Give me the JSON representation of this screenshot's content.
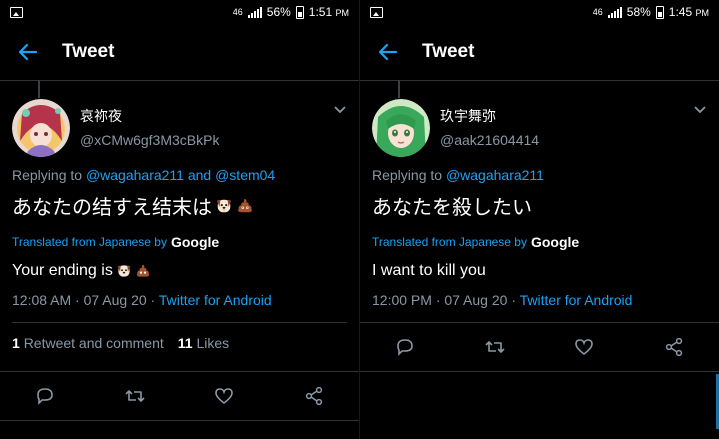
{
  "left": {
    "status": {
      "signal": "46",
      "battery": "56%",
      "time": "1:51",
      "ampm": "PM"
    },
    "header": {
      "title": "Tweet"
    },
    "tweet": {
      "display_name": "哀祢夜",
      "handle": "@xCMw6gf3M3cBkPk",
      "replying_prefix": "Replying to",
      "mentions": "@wagahara211 and @stem04",
      "text": "あなたの结すえ结末は",
      "translated_prefix": "Translated from Japanese by",
      "translated_brand": "Google",
      "translation": "Your ending is",
      "time_date": "12:08 AM · 07 Aug 20 ·",
      "source": "Twitter for Android"
    },
    "stats": {
      "retweets": "1",
      "retweet_label": "Retweet and comment",
      "likes": "11",
      "like_label": "Likes"
    }
  },
  "right": {
    "status": {
      "signal": "46",
      "battery": "58%",
      "time": "1:45",
      "ampm": "PM"
    },
    "header": {
      "title": "Tweet"
    },
    "tweet": {
      "display_name": "玖宇舞弥",
      "handle": "@aak21604414",
      "replying_prefix": "Replying to",
      "mentions": "@wagahara211",
      "text": "あなたを殺したい",
      "translated_prefix": "Translated from Japanese by",
      "translated_brand": "Google",
      "translation": "I want to kill you",
      "time_date": "12:00 PM · 07 Aug 20 ·",
      "source": "Twitter for Android"
    }
  },
  "icons": [
    "image-icon",
    "signal-icon",
    "battery-icon",
    "back-arrow-icon",
    "chevron-down-icon",
    "reply-icon",
    "retweet-icon",
    "like-icon",
    "share-icon",
    "dog-emoji",
    "pile-of-poo-emoji"
  ],
  "colors": {
    "background": "#000000",
    "accent": "#1da1f2",
    "secondary_text": "#8899a6",
    "divider": "#2f3336"
  }
}
